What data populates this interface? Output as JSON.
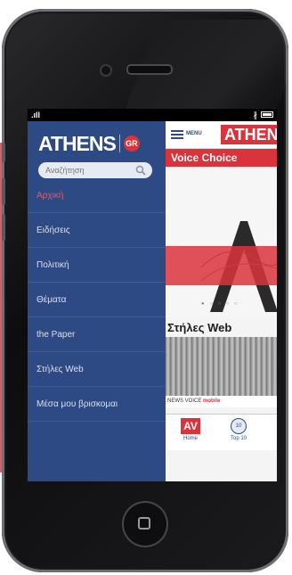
{
  "status_bar": {
    "signal": ".ıll",
    "bluetooth": "∦"
  },
  "menu": {
    "logo_text": "ATHENS",
    "logo_badge": "GR",
    "search_placeholder": "Αναζήτηση",
    "items": [
      {
        "label": "Αρχική",
        "active": true
      },
      {
        "label": "Ειδήσεις",
        "active": false
      },
      {
        "label": "Πολιτική",
        "active": false
      },
      {
        "label": "Θέματα",
        "active": false
      },
      {
        "label": "the Paper",
        "active": false
      },
      {
        "label": "Στήλες Web",
        "active": false
      },
      {
        "label": "Μέσα μου βρισκομαι",
        "active": false
      }
    ]
  },
  "content": {
    "menu_label": "MENU",
    "header_logo": "ATHENS",
    "banner": "Voice Choice",
    "section_title": "Στήλες Web",
    "news_strip_label": "NEWS VOICE",
    "news_strip_red": "mobile",
    "tabs": [
      {
        "icon_text": "AV",
        "label": "Home"
      },
      {
        "icon_text": "10",
        "label": "Top 10"
      }
    ]
  },
  "colors": {
    "menu_bg": "#2e4a84",
    "accent": "#d9343c",
    "active_text": "#f2555c"
  }
}
